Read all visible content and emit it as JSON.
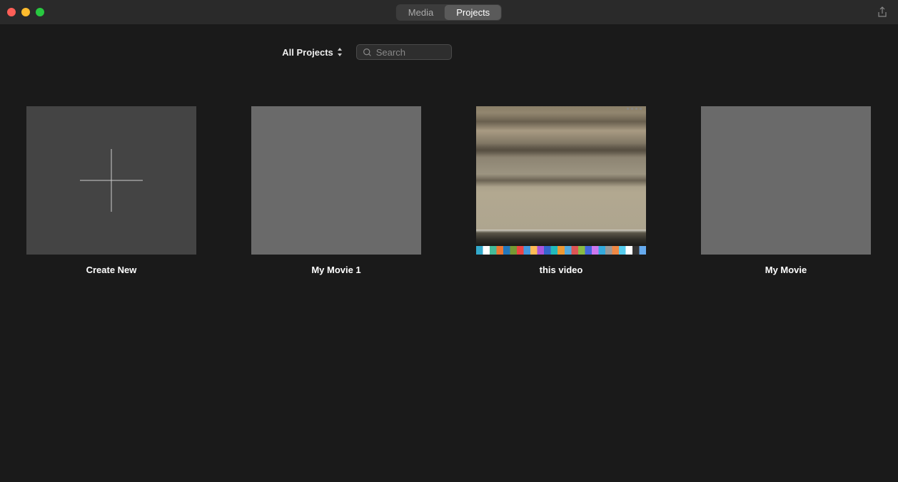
{
  "tabs": {
    "media": "Media",
    "projects": "Projects",
    "active": "projects"
  },
  "filter": {
    "label": "All Projects",
    "search_placeholder": "Search"
  },
  "projects": [
    {
      "label": "Create New",
      "type": "create"
    },
    {
      "label": "My Movie 1",
      "type": "blank"
    },
    {
      "label": "this video",
      "type": "screenshot"
    },
    {
      "label": "My Movie",
      "type": "blank"
    }
  ]
}
